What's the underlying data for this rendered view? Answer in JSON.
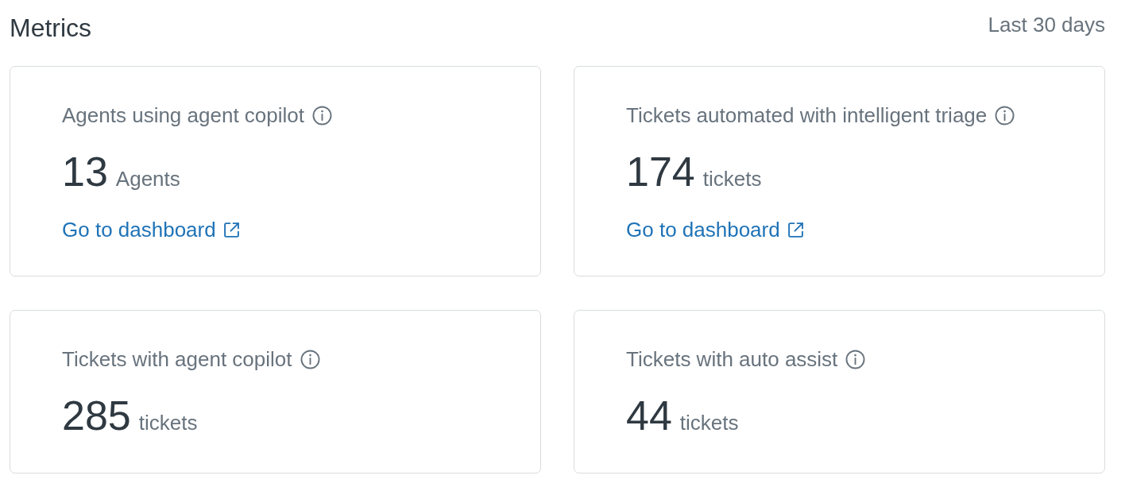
{
  "header": {
    "title": "Metrics",
    "period": "Last 30 days"
  },
  "cards": [
    {
      "label": "Agents using agent copilot",
      "value": "13",
      "unit": "Agents",
      "link": "Go to dashboard"
    },
    {
      "label": "Tickets automated with intelligent triage",
      "value": "174",
      "unit": "tickets",
      "link": "Go to dashboard"
    },
    {
      "label": "Tickets with agent copilot",
      "value": "285",
      "unit": "tickets"
    },
    {
      "label": "Tickets with auto assist",
      "value": "44",
      "unit": "tickets"
    }
  ]
}
